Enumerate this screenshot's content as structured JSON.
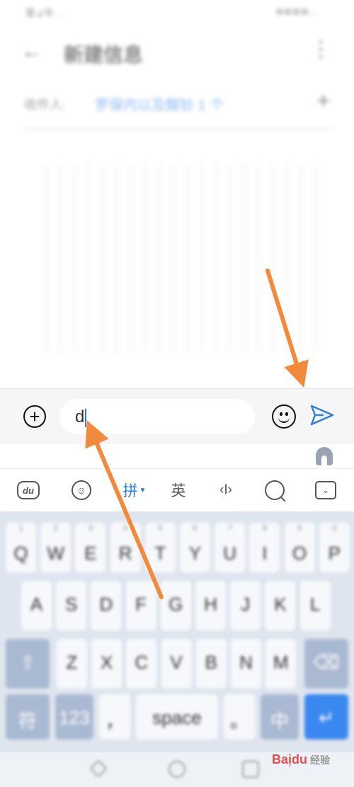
{
  "status_bar": {
    "left": "爱⊿令…",
    "right": "⊕⊕⊕⊕…"
  },
  "header": {
    "title": "新建信息"
  },
  "recipient": {
    "label": "收件人:",
    "value": "罗保内以及酸钞 1 个"
  },
  "compose": {
    "input_value": "d"
  },
  "ime_toolbar": {
    "du_label": "du",
    "emoji_label": "☺",
    "pinyin_label": "拼",
    "english_label": "英",
    "cursor_label": "‹I›",
    "hide_label": "⌄"
  },
  "keyboard": {
    "row1_nums": [
      "1",
      "2",
      "3",
      "4",
      "5",
      "6",
      "7",
      "8",
      "9",
      "0"
    ],
    "row1": [
      "Q",
      "W",
      "E",
      "R",
      "T",
      "Y",
      "U",
      "I",
      "O",
      "P"
    ],
    "row2": [
      "A",
      "S",
      "D",
      "F",
      "G",
      "H",
      "J",
      "K",
      "L"
    ],
    "row3": [
      "Z",
      "X",
      "C",
      "V",
      "B",
      "N",
      "M"
    ],
    "shift_label": "⇧",
    "delete_label": "⌫",
    "bottom": {
      "sym1": "符",
      "sym2": "123",
      "comma": "，",
      "space": "space",
      "period": "。",
      "lang": "中",
      "enter": "↵"
    }
  },
  "watermark": {
    "brand": "Bai᷊du",
    "suffix": "经验"
  },
  "colors": {
    "accent": "#2a7de1",
    "arrow": "#f28a3c",
    "keyboard_bg": "#dfe5ef",
    "enter_key": "#3b88f0"
  },
  "icons": {
    "back": "arrow-left-icon",
    "more": "more-vertical-icon",
    "add_recipient": "plus-icon",
    "attach": "plus-circle-icon",
    "emoji": "smiley-icon",
    "send": "send-icon",
    "suggest": "tip-icon",
    "search": "search-icon",
    "hide_keyboard": "chevron-down-icon"
  }
}
